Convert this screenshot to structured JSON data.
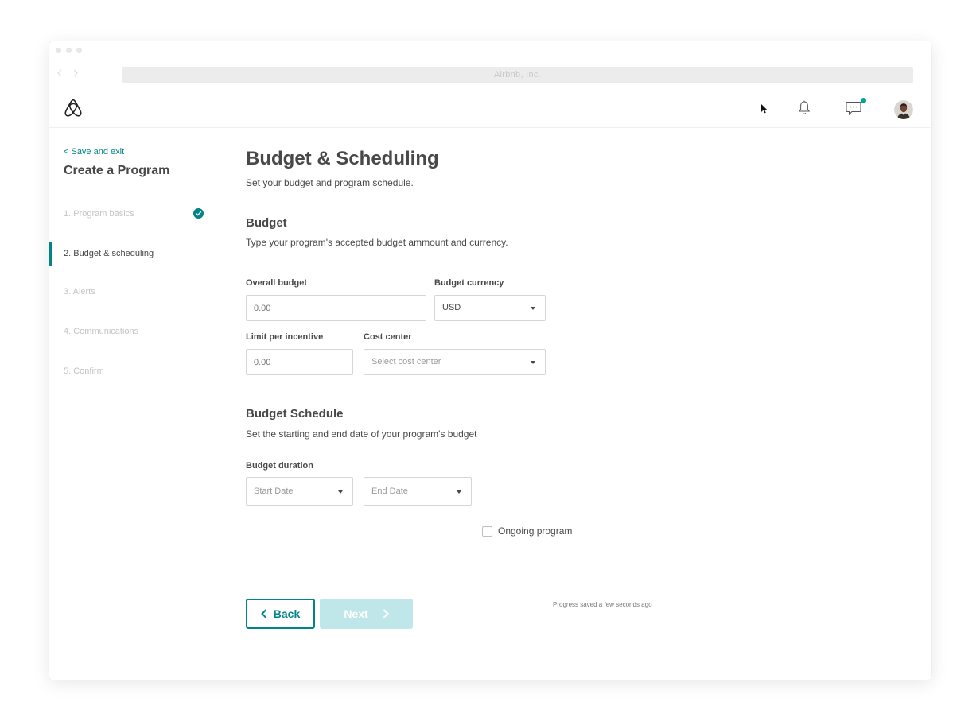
{
  "browser": {
    "url_title": "Airbnb, Inc."
  },
  "header": {
    "brand_icon": "airbnb-logo",
    "icons": [
      "cursor-icon",
      "bell-icon",
      "chat-icon",
      "avatar"
    ],
    "accent_color": "#008489",
    "notification_dot_color": "#00a699"
  },
  "sidebar": {
    "save_exit": "< Save and exit",
    "title": "Create a Program",
    "steps": [
      {
        "label": "1. Program basics",
        "state": "completed"
      },
      {
        "label": "2. Budget & scheduling",
        "state": "active"
      },
      {
        "label": "3. Alerts",
        "state": "pending"
      },
      {
        "label": "4. Communications",
        "state": "pending"
      },
      {
        "label": "5. Confirm",
        "state": "pending"
      }
    ]
  },
  "main": {
    "title": "Budget & Scheduling",
    "subtitle": "Set your budget and program schedule.",
    "budget": {
      "title": "Budget",
      "description": "Type your program's accepted budget ammount and currency.",
      "overall_budget_label": "Overall budget",
      "overall_budget_placeholder": "0.00",
      "currency_label": "Budget currency",
      "currency_value": "USD",
      "limit_label": "Limit per incentive",
      "limit_placeholder": "0.00",
      "cost_center_label": "Cost center",
      "cost_center_placeholder": "Select cost center"
    },
    "schedule": {
      "title": "Budget Schedule",
      "description": "Set the starting and end date of your program's budget",
      "duration_label": "Budget duration",
      "start_placeholder": "Start Date",
      "end_placeholder": "End Date",
      "ongoing_label": "Ongoing program",
      "ongoing_checked": false
    },
    "footer": {
      "back_label": "Back",
      "next_label": "Next",
      "progress_text": "Progress saved a few seconds ago"
    }
  }
}
